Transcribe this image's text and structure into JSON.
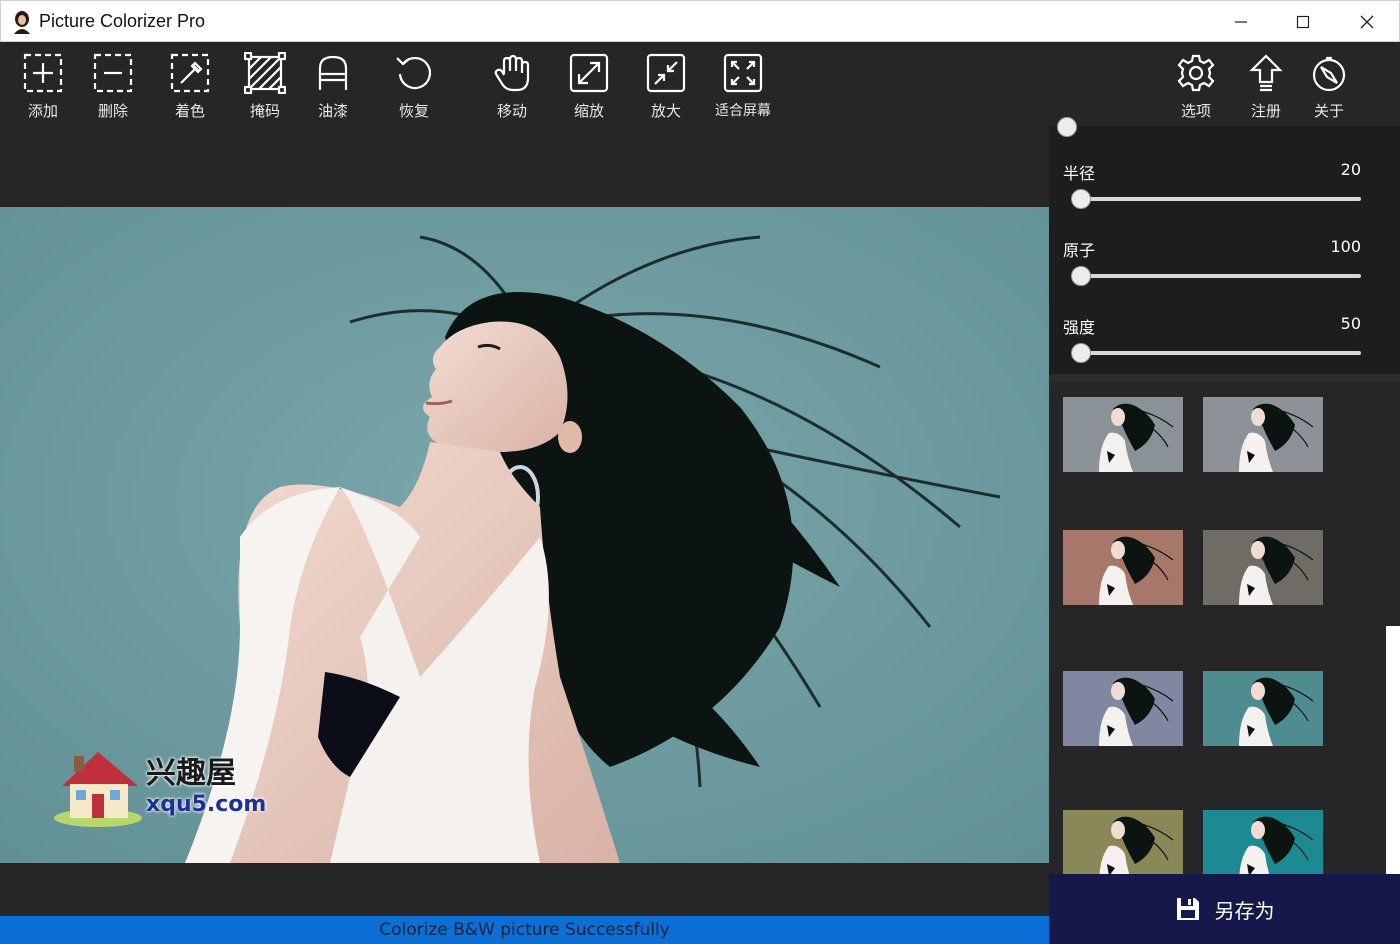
{
  "window": {
    "title": "Picture Colorizer Pro"
  },
  "toolbar": {
    "tools": [
      {
        "id": "add",
        "label": "添加",
        "icon": "add-icon"
      },
      {
        "id": "delete",
        "label": "删除",
        "icon": "remove-icon"
      },
      {
        "id": "colorize",
        "label": "着色",
        "icon": "eyedropper-icon"
      },
      {
        "id": "mask",
        "label": "掩码",
        "icon": "mask-icon"
      },
      {
        "id": "paint",
        "label": "油漆",
        "icon": "paint-icon"
      },
      {
        "id": "restore",
        "label": "恢复",
        "icon": "undo-icon"
      },
      {
        "id": "move",
        "label": "移动",
        "icon": "hand-icon"
      },
      {
        "id": "zoom",
        "label": "缩放",
        "icon": "expand-icon"
      },
      {
        "id": "enlarge",
        "label": "放大",
        "icon": "shrink-icon"
      },
      {
        "id": "fit",
        "label": "适合屏幕",
        "icon": "fit-screen-icon"
      }
    ],
    "right_tools": [
      {
        "id": "options",
        "label": "选项",
        "icon": "gear-icon"
      },
      {
        "id": "register",
        "label": "注册",
        "icon": "upload-arrow-icon"
      },
      {
        "id": "about",
        "label": "关于",
        "icon": "compass-icon"
      }
    ]
  },
  "panel": {
    "sliders": [
      {
        "label": "半径",
        "value": "20",
        "level": 0
      },
      {
        "label": "原子",
        "value": "100",
        "level": 0
      },
      {
        "label": "强度",
        "value": "50",
        "level": 0
      }
    ]
  },
  "thumbnails": [
    {
      "tint": "#8a9298"
    },
    {
      "tint": "#8d9299"
    },
    {
      "tint": "#a7786a"
    },
    {
      "tint": "#6f6c66"
    },
    {
      "tint": "#7f88a0"
    },
    {
      "tint": "#4f8c90"
    },
    {
      "tint": "#8b8857"
    },
    {
      "tint": "#1d8a93"
    }
  ],
  "photo": {
    "background": "#6f9ca1"
  },
  "watermark": {
    "name": "兴趣屋",
    "url": "xqu5.com"
  },
  "status": {
    "message": "Colorize B&W picture Successfully"
  },
  "save": {
    "label": "另存为"
  },
  "colors": {
    "toolbar_bg": "#262629",
    "panel_bg": "#1d1d1f",
    "status_bg": "#0b6fd6",
    "save_bg": "#15184a"
  }
}
